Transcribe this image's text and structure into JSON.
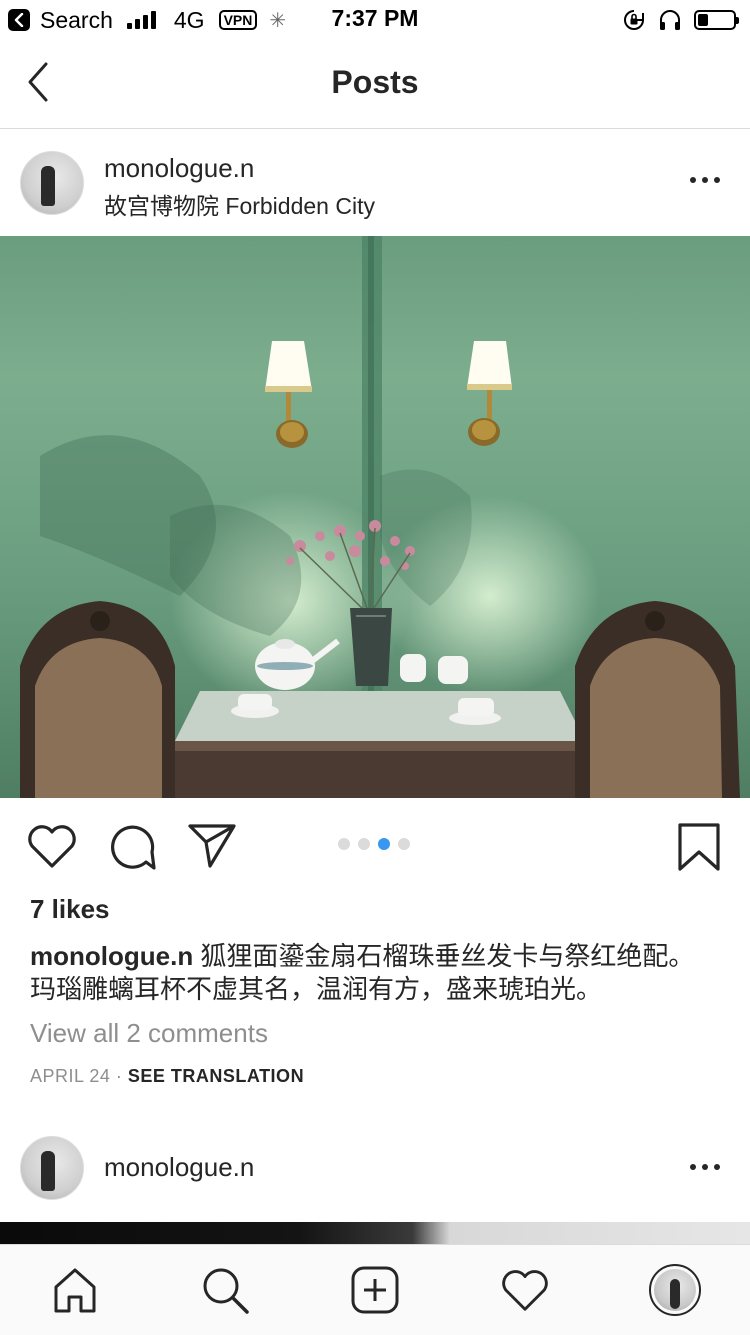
{
  "status_bar": {
    "back_app": "Search",
    "network": "4G",
    "vpn": "VPN",
    "time": "7:37 PM",
    "battery_level": 0.3
  },
  "nav": {
    "title": "Posts"
  },
  "post": {
    "username": "monologue.n",
    "location": "故宫博物院 Forbidden City",
    "likes": "7 likes",
    "caption_user": "monologue.n",
    "caption_text": " 狐狸面鎏金扇石榴珠垂丝发卡与祭红绝配。玛瑙雕螭耳杯不虚其名，温润有方，盛来琥珀光。",
    "view_comments": "View all 2 comments",
    "date": "APRIL 24",
    "separator": " · ",
    "translate": "SEE TRANSLATION",
    "carousel": {
      "count": 4,
      "active": 2
    }
  },
  "next_post": {
    "username": "monologue.n"
  },
  "tabbar": {
    "items": [
      "home-icon",
      "search-icon",
      "add-post-icon",
      "activity-heart-icon",
      "profile-avatar"
    ]
  },
  "colors": {
    "accent": "#3897f0",
    "text": "#262626",
    "muted": "#8e8e8e",
    "divider": "#dbdbdb"
  }
}
